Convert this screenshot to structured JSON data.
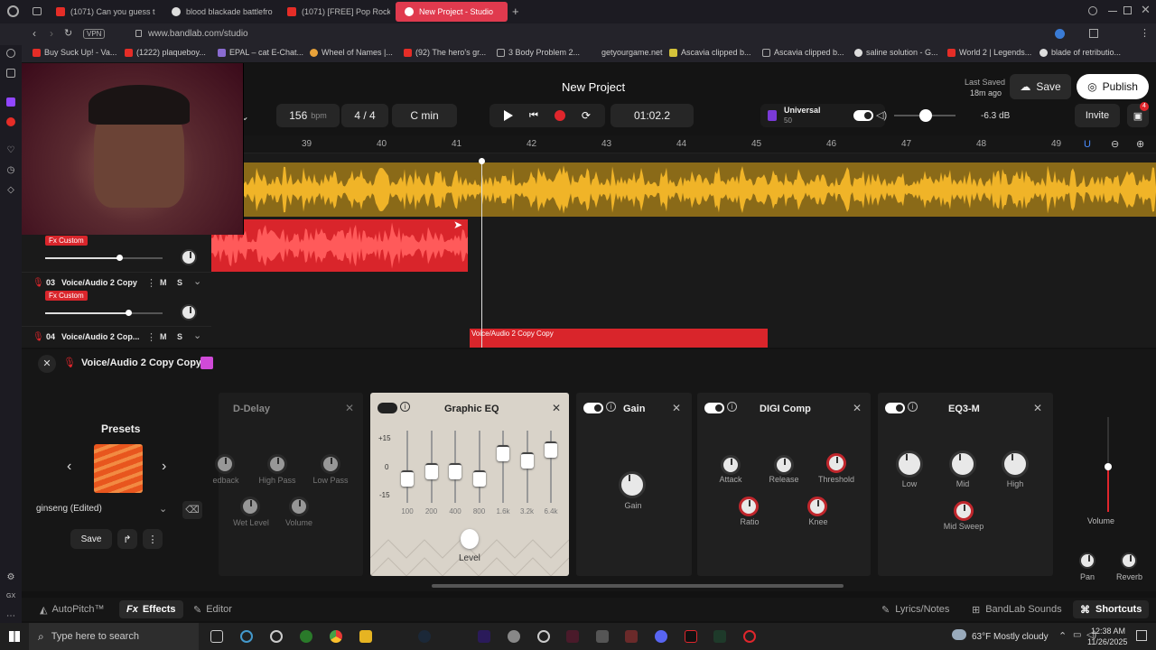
{
  "browser": {
    "tabs": [
      {
        "label": "(1071) Can you guess the",
        "color": "#e52d27"
      },
      {
        "label": "blood blackade battlefron",
        "color": "#ddd"
      },
      {
        "label": "(1071) [FREE] Pop Rock x",
        "color": "#e52d27"
      },
      {
        "label": "New Project - Studio",
        "color": "#fff"
      }
    ],
    "url": "www.bandlab.com/studio",
    "vpn_label": "VPN",
    "bookmarks": [
      "Buy Suck Up! - Va...",
      "(1222) plaqueboy...",
      "EPAL – cat E-Chat...",
      "Wheel of Names |...",
      "(92) The hero's gr...",
      "3 Body Problem 2...",
      "getyourgame.net",
      "Ascavia clipped b...",
      "Ascavia clipped b...",
      "saline solution - G...",
      "World 2 | Legends...",
      "blade of retributio..."
    ]
  },
  "header": {
    "project_title": "New Project",
    "bpm_value": "156",
    "bpm_unit": "bpm",
    "time_sig": "4 / 4",
    "key": "C min",
    "time": "01:02.2",
    "last_saved_label": "Last Saved",
    "last_saved_value": "18m ago",
    "save_label": "Save",
    "publish_label": "Publish",
    "invite_label": "Invite",
    "universal_label": "Universal",
    "universal_sub": "50",
    "db_value": "-6.3 dB",
    "notif_count": "4"
  },
  "ruler": [
    "39",
    "40",
    "41",
    "42",
    "43",
    "44",
    "45",
    "46",
    "47",
    "48",
    "49"
  ],
  "tracks": [
    {
      "fx_badge": "Fx Custom"
    },
    {
      "num": "03",
      "name": "Voice/Audio 2 Copy",
      "fx_badge": "Fx Custom"
    },
    {
      "num": "04",
      "name": "Voice/Audio 2 Cop..."
    }
  ],
  "clip_label": "Voice/Audio 2 Copy Copy",
  "mute_label": "M",
  "solo_label": "S",
  "fxpanel": {
    "track_name": "Voice/Audio 2 Copy Copy",
    "presets_title": "Presets",
    "preset_name": "ginseng (Edited)",
    "save_label": "Save",
    "delay": {
      "title": "D-Delay",
      "knobs": [
        "edback",
        "High Pass",
        "Low Pass",
        "Wet Level",
        "Volume"
      ]
    },
    "eq": {
      "title": "Graphic EQ",
      "scale": [
        "+15",
        "0",
        "-15"
      ],
      "bands": [
        "100",
        "200",
        "400",
        "800",
        "1.6k",
        "3.2k",
        "6.4k"
      ],
      "levels": [
        0.35,
        0.45,
        0.45,
        0.35,
        0.7,
        0.6,
        0.75
      ],
      "level_label": "Level"
    },
    "gain": {
      "title": "Gain",
      "knob": "Gain"
    },
    "comp": {
      "title": "DIGI Comp",
      "knobs": [
        "Attack",
        "Release",
        "Threshold",
        "Ratio",
        "Knee"
      ]
    },
    "eq3": {
      "title": "EQ3-M",
      "knobs": [
        "Low",
        "Mid",
        "High",
        "Mid Sweep"
      ]
    },
    "master": {
      "volume": "Volume",
      "pan": "Pan",
      "reverb": "Reverb"
    }
  },
  "bottom": {
    "autopitch": "AutoPitch™",
    "effects": "Effects",
    "editor": "Editor",
    "lyrics": "Lyrics/Notes",
    "sounds": "BandLab Sounds",
    "shortcuts": "Shortcuts"
  },
  "taskbar": {
    "search_placeholder": "Type here to search",
    "weather": "63°F  Mostly cloudy",
    "time": "12:38 AM",
    "date": "11/26/2025"
  },
  "colors": {
    "accent_red": "#e0262c",
    "waveform_yellow": "#f0b428",
    "brand": "#e03a4e"
  }
}
